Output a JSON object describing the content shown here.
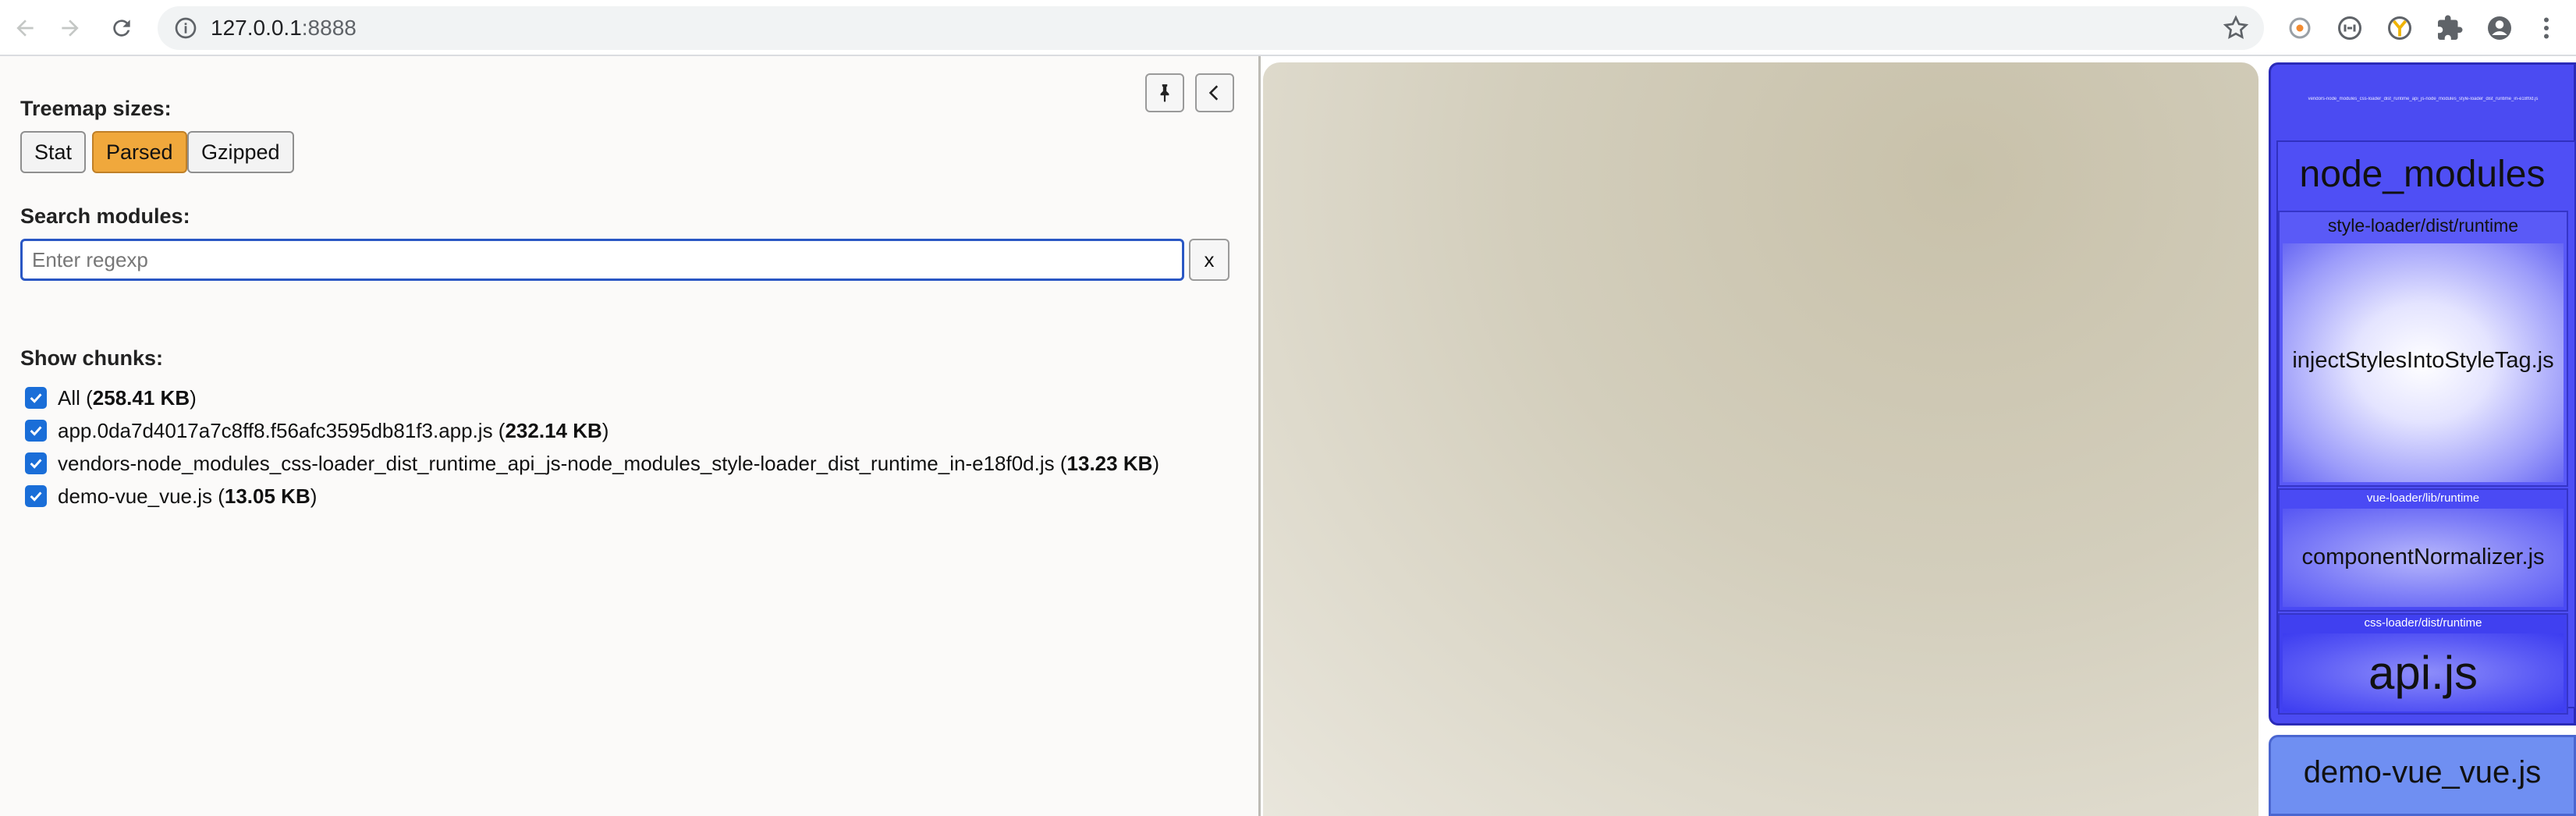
{
  "browser": {
    "url_host": "127.0.0.1",
    "url_port": ":8888"
  },
  "sidebar": {
    "treemap_sizes_label": "Treemap sizes:",
    "size_buttons": [
      "Stat",
      "Parsed",
      "Gzipped"
    ],
    "active_size": "Parsed",
    "search_label": "Search modules:",
    "search_placeholder": "Enter regexp",
    "search_value": "",
    "clear_label": "x",
    "show_chunks_label": "Show chunks:",
    "chunks": [
      {
        "name": "All",
        "size": "258.41 KB",
        "checked": true
      },
      {
        "name": "app.0da7d4017a7c8ff8.f56afc3595db81f3.app.js",
        "size": "232.14 KB",
        "checked": true
      },
      {
        "name": "vendors-node_modules_css-loader_dist_runtime_api_js-node_modules_style-loader_dist_runtime_in-e18f0d.js",
        "size": "13.23 KB",
        "checked": true
      },
      {
        "name": "demo-vue_vue.js",
        "size": "13.05 KB",
        "checked": true
      }
    ]
  },
  "treemap": {
    "vendors_label": "vendors-node_modules_css-loader_dist_runtime_api_js-node_modules_style-loader_dist_runtime_in-e18f0d.js",
    "node_modules": "node_modules",
    "style_loader": "style-loader/dist/runtime",
    "inject": "injectStylesIntoStyleTag.js",
    "vue_loader": "vue-loader/lib/runtime",
    "component_normalizer": "componentNormalizer.js",
    "css_loader": "css-loader/dist/runtime",
    "api": "api.js",
    "demo": "demo-vue_vue.js"
  }
}
